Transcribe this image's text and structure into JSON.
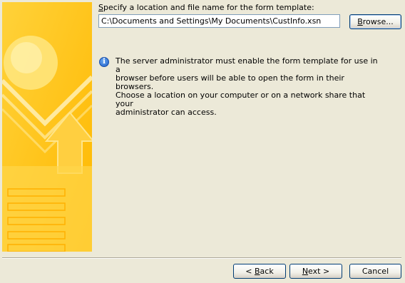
{
  "form": {
    "label_prefix": "",
    "label_accel": "S",
    "label_rest": "pecify a location and file name for the form template:",
    "path_value": "C:\\Documents and Settings\\My Documents\\CustInfo.xsn"
  },
  "buttons": {
    "browse_accel": "B",
    "browse_rest": "rowse...",
    "back_prefix": "< ",
    "back_accel": "B",
    "back_rest": "ack",
    "next_accel": "N",
    "next_rest": "ext >",
    "cancel_label": "Cancel"
  },
  "info": {
    "icon": "info-icon",
    "icon_glyph": "i",
    "lines": [
      "The server administrator must enable the form template for use in a",
      "browser before users will be able to open the form in their browsers.",
      "Choose a location on your computer or on a network share that your",
      "administrator can access."
    ]
  },
  "colors": {
    "background": "#ece9d8",
    "banner": "#ffc21a",
    "button_border": "#003c74",
    "input_border": "#7f9db9"
  }
}
